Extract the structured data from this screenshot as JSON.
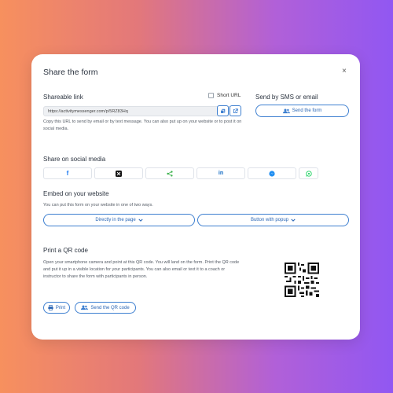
{
  "modal": {
    "title": "Share the form",
    "close_glyph": "×"
  },
  "shareable": {
    "heading": "Shareable link",
    "short_url_label": "Short URL",
    "url": "https://activitymessenger.com/p/5RZ83Hq",
    "description": "Copy this URL to send by email or by text message. You can also put up on your website or to post it on social media."
  },
  "sms": {
    "heading": "Send by SMS or email",
    "button_label": "Send the form"
  },
  "social": {
    "heading": "Share on social media",
    "networks": [
      "facebook-icon",
      "x-icon",
      "share-icon",
      "linkedin-icon",
      "messenger-icon",
      "whatsapp-icon"
    ]
  },
  "embed": {
    "heading": "Embed on your website",
    "description": "You can put this form on your website in one of two ways.",
    "option1": "Directly in the page",
    "option2": "Button with popup"
  },
  "qr": {
    "heading": "Print a QR code",
    "description": "Open your smartphone camera and point at this QR code. You will land on the form. Print the QR code and put it up in a visible location for your participants. You can also email or text it to a coach or instructor to share the form with participants in person.",
    "print_label": "Print",
    "send_label": "Send the QR code"
  },
  "colors": {
    "accent": "#3d7fd0",
    "facebook": "#1877f2",
    "share": "#3fb34f",
    "linkedin": "#0a66c2",
    "messenger": "#1f8ef1",
    "whatsapp": "#25d366"
  }
}
